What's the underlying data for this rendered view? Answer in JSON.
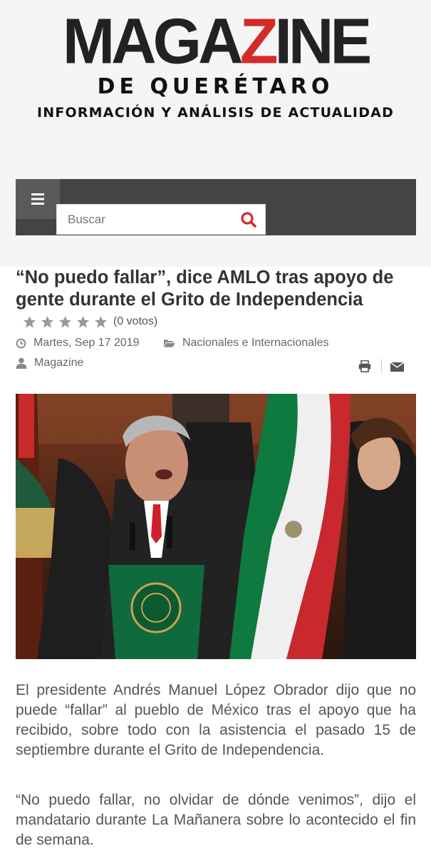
{
  "logo": {
    "main_left": "MAGA",
    "main_z": "Z",
    "main_right": "INE",
    "sub": "DE QUERÉTARO",
    "tagline": "INFORMACIÓN Y ANÁLISIS DE ACTUALIDAD"
  },
  "nav": {
    "menu_icon": "hamburger-icon",
    "search_placeholder": "Buscar",
    "search_icon": "search-icon",
    "accent_color": "#d52a2a"
  },
  "article": {
    "title": "“No puedo fallar”, dice AMLO tras apoyo de gente durante el Grito de Independencia",
    "rating": {
      "stars_filled": 0,
      "stars_total": 5,
      "votes_label": "(0 votos)"
    },
    "date": "Martes, Sep 17 2019",
    "category": "Nacionales e Internacionales",
    "author": "Magazine",
    "tools": [
      "print-icon",
      "envelope-icon"
    ],
    "image_icon": "photo",
    "paragraphs": [
      "El presidente Andrés Manuel López Obrador dijo que no puede “fallar” al pueblo de México tras el apoyo que ha recibido, sobre todo con la asistencia el pasado 15 de septiembre durante el Grito de Independencia.",
      "“No puedo fallar, no olvidar de dónde venimos”, dijo el mandatario durante La Mañanera sobre lo acontecido el fin de semana."
    ]
  }
}
